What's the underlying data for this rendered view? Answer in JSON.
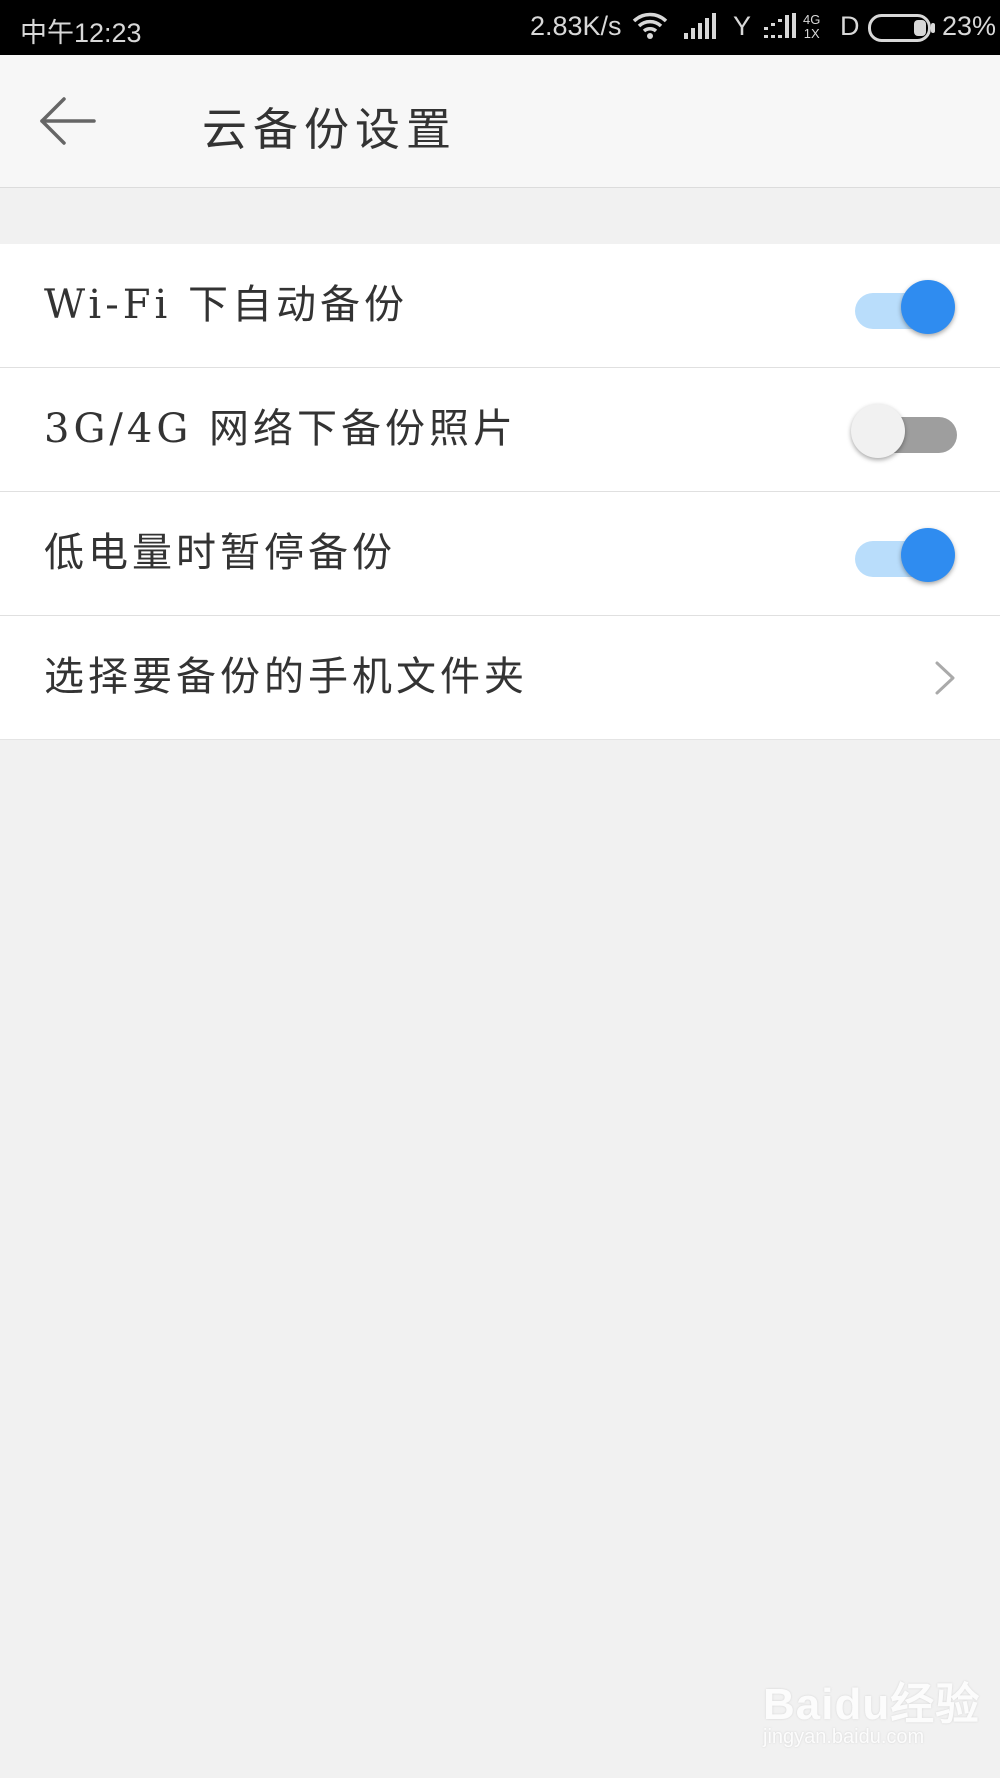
{
  "status_bar": {
    "time": "中午12:23",
    "speed": "2.83K/s",
    "carrier_y": "Y",
    "net_type_top": "4G",
    "net_type_bottom": "1X",
    "d_label": "D",
    "battery_percent": "23%",
    "battery_level": 0.23,
    "icons": [
      "wifi-icon",
      "signal-icon",
      "signal-icon",
      "battery-icon"
    ]
  },
  "header": {
    "back_icon": "arrow-left-icon",
    "title": "云备份设置"
  },
  "settings": [
    {
      "label": "Wi-Fi 下自动备份",
      "type": "toggle",
      "enabled": true
    },
    {
      "label": "3G/4G 网络下备份照片",
      "type": "toggle",
      "enabled": false
    },
    {
      "label": "低电量时暂停备份",
      "type": "toggle",
      "enabled": true
    },
    {
      "label": "选择要备份的手机文件夹",
      "type": "link",
      "icon": "chevron-right-icon"
    }
  ],
  "colors": {
    "accent": "#2f8cf0",
    "accent_track": "#b9ddfb",
    "off_track": "#9e9e9e",
    "background": "#f1f1f1"
  },
  "watermark": {
    "brand": "Baidu经验",
    "url": "jingyan.baidu.com"
  }
}
